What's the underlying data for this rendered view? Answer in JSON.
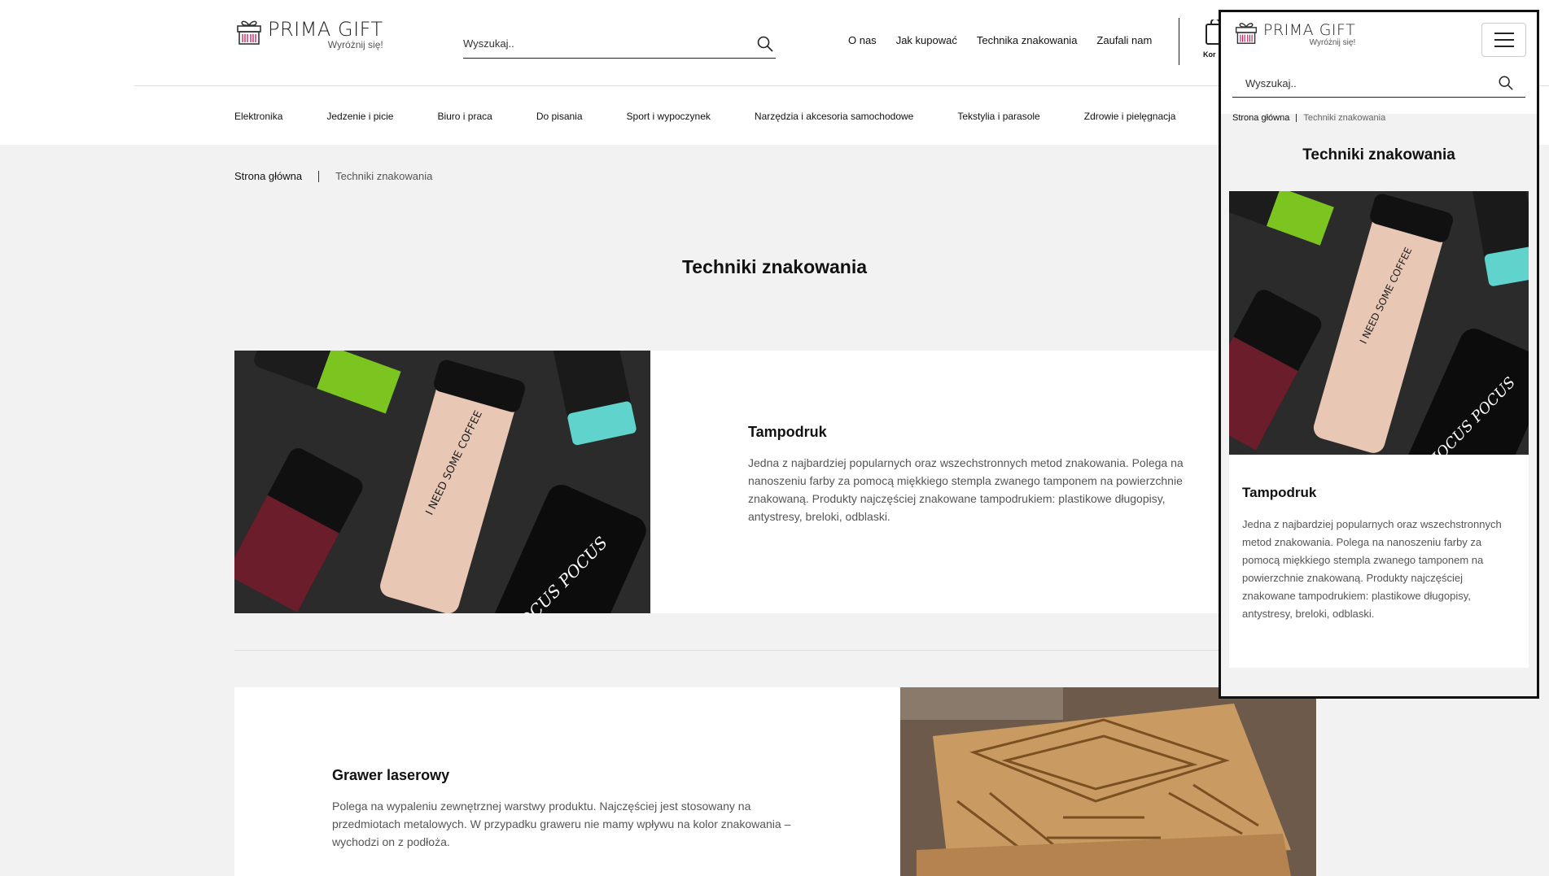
{
  "header": {
    "brand": "PRIMA GIFT",
    "tagline": "Wyróżnij się!",
    "search_placeholder": "Wyszukaj..",
    "top_nav": [
      "O nas",
      "Jak kupować",
      "Technika znakowania",
      "Zaufali nam"
    ],
    "cart_label_partial": "Kor",
    "categories": [
      "Elektronika",
      "Jedzenie i picie",
      "Biuro i praca",
      "Do pisania",
      "Sport i wypoczynek",
      "Narzędzia i akcesoria samochodowe",
      "Tekstylia i parasole",
      "Zdrowie i pielęgnacja"
    ]
  },
  "breadcrumb": {
    "home": "Strona główna",
    "current": "Techniki znakowania"
  },
  "page_title": "Techniki znakowania",
  "sections": [
    {
      "title": "Tampodruk",
      "description": "Jedna z najbardziej popularnych oraz wszechstronnych metod znakowania. Polega na nanoszeniu farby za pomocą miękkiego stempla zwanego tamponem na powierzchnie znakowaną. Produkty najczęściej znakowane tampodrukiem: plastikowe długopisy, antystresy, breloki, odblaski.",
      "image": "travel-mugs-photo",
      "image_texts": [
        "I NEED SOME COFFEE",
        "HOCUS POCUS"
      ]
    },
    {
      "title": "Grawer laserowy",
      "description": "Polega na wypaleniu zewnętrznej warstwy produktu. Najczęściej jest stosowany na przedmiotach metalowych. W przypadku graweru nie mamy wpływu na kolor znakowania – wychodzi on z podłoża.",
      "image": "wooden-coasters-photo"
    }
  ],
  "mobile": {
    "brand": "PRIMA GIFT",
    "tagline": "Wyróżnij się!",
    "search_placeholder": "Wyszukaj..",
    "breadcrumb_home": "Strona główna",
    "breadcrumb_current": "Techniki znakowania",
    "title": "Techniki znakowania",
    "section_title": "Tampodruk",
    "section_description": "Jedna z najbardziej popularnych oraz wszechstronnych metod znakowania. Polega na nanoszeniu farby za pomocą miękkiego stempla zwanego tamponem na powierzchnie znakowaną. Produkty najczęściej znakowane tampodrukiem: plastikowe długopisy, antystresy, breloki, odblaski."
  },
  "colors": {
    "background": "#f2f2f2",
    "card": "#ffffff",
    "logo_accent": "#c2185b",
    "text": "#111111",
    "muted_text": "#555555"
  }
}
